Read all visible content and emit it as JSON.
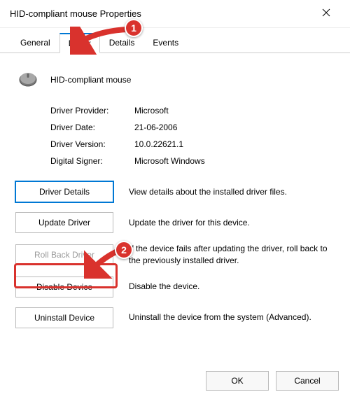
{
  "window": {
    "title": "HID-compliant mouse Properties"
  },
  "tabs": {
    "general": "General",
    "driver": "Driver",
    "details": "Details",
    "events": "Events",
    "active": "driver"
  },
  "device": {
    "name": "HID-compliant mouse"
  },
  "info": {
    "provider_label": "Driver Provider:",
    "provider_value": "Microsoft",
    "date_label": "Driver Date:",
    "date_value": "21-06-2006",
    "version_label": "Driver Version:",
    "version_value": "10.0.22621.1",
    "signer_label": "Digital Signer:",
    "signer_value": "Microsoft Windows"
  },
  "actions": {
    "driver_details": {
      "label": "Driver Details",
      "desc": "View details about the installed driver files."
    },
    "update_driver": {
      "label": "Update Driver",
      "desc": "Update the driver for this device."
    },
    "rollback": {
      "label": "Roll Back Driver",
      "desc": "If the device fails after updating the driver, roll back to the previously installed driver."
    },
    "disable": {
      "label": "Disable Device",
      "desc": "Disable the device."
    },
    "uninstall": {
      "label": "Uninstall Device",
      "desc": "Uninstall the device from the system (Advanced)."
    }
  },
  "footer": {
    "ok": "OK",
    "cancel": "Cancel"
  },
  "annotations": {
    "callout1": "1",
    "callout2": "2"
  }
}
